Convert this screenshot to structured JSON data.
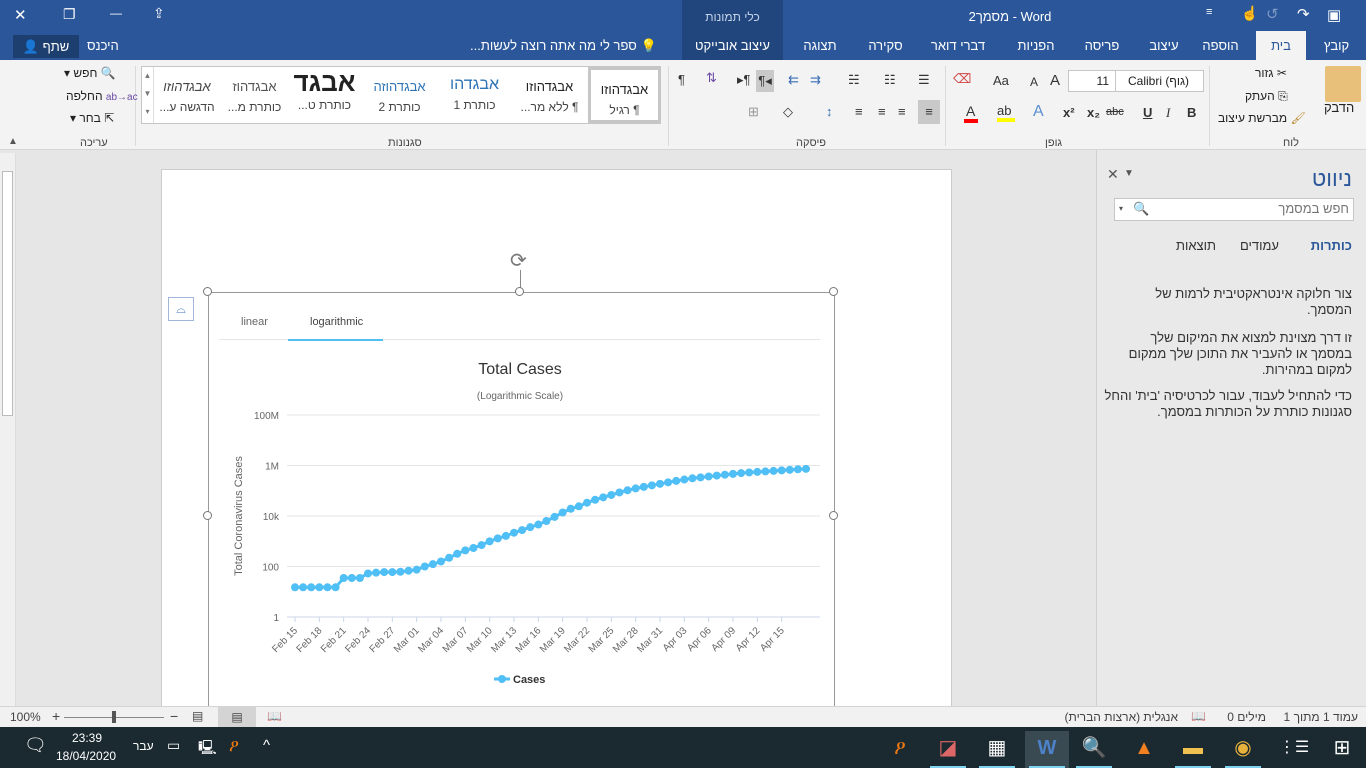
{
  "titlebar": {
    "title": "מסמך2 - Word",
    "context_group": "כלי תמונות",
    "qat": {
      "save": "save-icon",
      "redo": "redo-icon",
      "undo": "undo-icon",
      "touch": "touch-mode-icon",
      "customize": "customize-icon"
    },
    "window_controls": {
      "close": "✕",
      "restore": "❐",
      "minimize": "—",
      "ribbon_display": "⇪"
    }
  },
  "tabs": [
    {
      "label": "קובץ"
    },
    {
      "label": "בית",
      "active": true
    },
    {
      "label": "הוספה"
    },
    {
      "label": "עיצוב"
    },
    {
      "label": "פריסה"
    },
    {
      "label": "הפניות"
    },
    {
      "label": "דברי דואר"
    },
    {
      "label": "סקירה"
    },
    {
      "label": "תצוגה"
    },
    {
      "label": "עיצוב אובייקט"
    }
  ],
  "tell_me": "ספר לי מה אתה רוצה לעשות...",
  "signin": "היכנס",
  "share": "שתף",
  "ribbon": {
    "clipboard": {
      "group": "לוח",
      "paste": "הדבק",
      "cut": "גזור",
      "copy": "העתק",
      "format_painter": "מברשת עיצוב"
    },
    "font": {
      "group": "גופן",
      "font_name": "Calibri (גוף)",
      "font_size": "11",
      "bold": "B",
      "italic": "I",
      "underline": "U",
      "strike": "abc",
      "subscript": "x₂",
      "superscript": "x²",
      "change_case": "Aa",
      "grow": "A",
      "shrink": "A",
      "font_color": "#ff0000",
      "highlight_color": "#ffff00"
    },
    "paragraph": {
      "group": "פיסקה",
      "pilcrow": "¶"
    },
    "styles": {
      "group": "סגנונות",
      "items": [
        {
          "preview": "אבגדהוזו",
          "name": "¶ רגיל"
        },
        {
          "preview": "אבגדהוזו",
          "name": "¶ ללא מר..."
        },
        {
          "preview": "אבגדהו",
          "name": "כותרת 1"
        },
        {
          "preview": "אבגדהוזה",
          "name": "כותרת 2"
        },
        {
          "preview": "אבגד",
          "name": "כותרת ט..."
        },
        {
          "preview": "אבגדהוז",
          "name": "כותרת מ..."
        },
        {
          "preview": "אבגדהוזו",
          "name": "הדגשה ע..."
        }
      ]
    },
    "editing": {
      "group": "עריכה",
      "find": "חפש",
      "replace": "החלפה",
      "select": "בחר"
    }
  },
  "nav": {
    "title": "ניווט",
    "search_placeholder": "חפש במסמך",
    "tabs": [
      "כותרות",
      "עמודים",
      "תוצאות"
    ],
    "p1": "צור חלוקה אינטראקטיבית לרמות של המסמך.",
    "p2": "זו דרך מצוינת למצוא את המיקום שלך במסמך או להעביר את התוכן שלך ממקום למקום במהירות.",
    "p3": "כדי להתחיל לעבוד, עבור לכרטיסיה 'בית' והחל סגנונות כותרת על הכותרות במסמך."
  },
  "chart_tabs": [
    "linear",
    "logarithmic"
  ],
  "chart_data": {
    "type": "line",
    "title": "Total Cases",
    "subtitle": "(Logarithmic Scale)",
    "ylabel": "Total Coronavirus Cases",
    "xlabel": "",
    "y_scale": "log",
    "ylim": [
      1,
      100000000
    ],
    "y_ticks": [
      {
        "v": 1,
        "label": "1"
      },
      {
        "v": 100,
        "label": "100"
      },
      {
        "v": 10000,
        "label": "10k"
      },
      {
        "v": 1000000,
        "label": "1M"
      },
      {
        "v": 100000000,
        "label": "100M"
      }
    ],
    "grid": true,
    "legend": "bottom",
    "color": "#4fbff5",
    "x": [
      "Feb 15",
      "Feb 16",
      "Feb 17",
      "Feb 18",
      "Feb 19",
      "Feb 20",
      "Feb 21",
      "Feb 22",
      "Feb 23",
      "Feb 24",
      "Feb 25",
      "Feb 26",
      "Feb 27",
      "Feb 28",
      "Feb 29",
      "Mar 01",
      "Mar 02",
      "Mar 03",
      "Mar 04",
      "Mar 05",
      "Mar 06",
      "Mar 07",
      "Mar 08",
      "Mar 09",
      "Mar 10",
      "Mar 11",
      "Mar 12",
      "Mar 13",
      "Mar 14",
      "Mar 15",
      "Mar 16",
      "Mar 17",
      "Mar 18",
      "Mar 19",
      "Mar 20",
      "Mar 21",
      "Mar 22",
      "Mar 23",
      "Mar 24",
      "Mar 25",
      "Mar 26",
      "Mar 27",
      "Mar 28",
      "Mar 29",
      "Mar 30",
      "Mar 31",
      "Apr 01",
      "Apr 02",
      "Apr 03",
      "Apr 04",
      "Apr 05",
      "Apr 06",
      "Apr 07",
      "Apr 08",
      "Apr 09",
      "Apr 10",
      "Apr 11",
      "Apr 12",
      "Apr 13",
      "Apr 14",
      "Apr 15",
      "Apr 16",
      "Apr 17",
      "Apr 18"
    ],
    "x_tick_labels": [
      "Feb 15",
      "Feb 18",
      "Feb 21",
      "Feb 24",
      "Feb 27",
      "Mar 01",
      "Mar 04",
      "Mar 07",
      "Mar 10",
      "Mar 13",
      "Mar 16",
      "Mar 19",
      "Mar 22",
      "Mar 25",
      "Mar 28",
      "Mar 31",
      "Apr 03",
      "Apr 06",
      "Apr 09",
      "Apr 12",
      "Apr 15"
    ],
    "series": [
      {
        "name": "Cases",
        "values": [
          15,
          15,
          15,
          15,
          15,
          15,
          35,
          35,
          35,
          53,
          57,
          60,
          60,
          62,
          68,
          75,
          100,
          124,
          158,
          221,
          319,
          435,
          541,
          704,
          994,
          1301,
          1630,
          2183,
          2770,
          3613,
          4596,
          6344,
          9197,
          13779,
          19367,
          24192,
          33592,
          43781,
          54856,
          68211,
          85435,
          104126,
          123578,
          142460,
          163844,
          188172,
          215344,
          245601,
          277828,
          312146,
          337635,
          368196,
          398809,
          432132,
          466299,
          501560,
          529951,
          557590,
          582619,
          609685,
          640291,
          672303,
          706779,
          738830
        ]
      }
    ]
  },
  "status": {
    "page": "עמוד 1 מתוך 1",
    "words": "0 מילים",
    "language": "אנגלית (ארצות הברית)",
    "zoom": "100%",
    "zoom_level": 100
  },
  "taskbar": {
    "time": "23:39",
    "date": "18/04/2020",
    "lang": "עבר"
  }
}
